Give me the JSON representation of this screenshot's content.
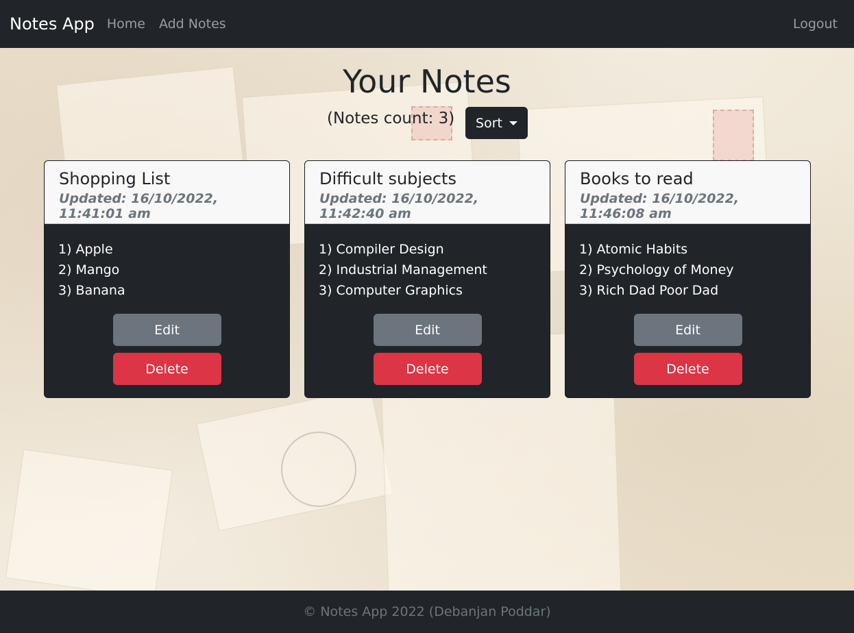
{
  "navbar": {
    "brand": "Notes App",
    "links": [
      "Home",
      "Add Notes"
    ],
    "logout": "Logout"
  },
  "main": {
    "title": "Your Notes",
    "count_text": "(Notes count: 3)",
    "sort_label": "Sort"
  },
  "notes": [
    {
      "title": "Shopping List",
      "updated": "Updated: 16/10/2022, 11:41:01 am",
      "lines": [
        "1) Apple",
        "2) Mango",
        "3) Banana"
      ],
      "edit_label": "Edit",
      "delete_label": "Delete"
    },
    {
      "title": "Difficult subjects",
      "updated": "Updated: 16/10/2022, 11:42:40 am",
      "lines": [
        "1) Compiler Design",
        "2) Industrial Management",
        "3) Computer Graphics"
      ],
      "edit_label": "Edit",
      "delete_label": "Delete"
    },
    {
      "title": "Books to read",
      "updated": "Updated: 16/10/2022, 11:46:08 am",
      "lines": [
        "1) Atomic Habits",
        "2) Psychology of Money",
        "3) Rich Dad Poor Dad"
      ],
      "edit_label": "Edit",
      "delete_label": "Delete"
    }
  ],
  "footer": {
    "text": "© Notes App 2022 (Debanjan Poddar)"
  },
  "colors": {
    "navbar": "#212529",
    "card_body": "#212529",
    "edit_button": "#6c757d",
    "delete_button": "#dc3545"
  }
}
